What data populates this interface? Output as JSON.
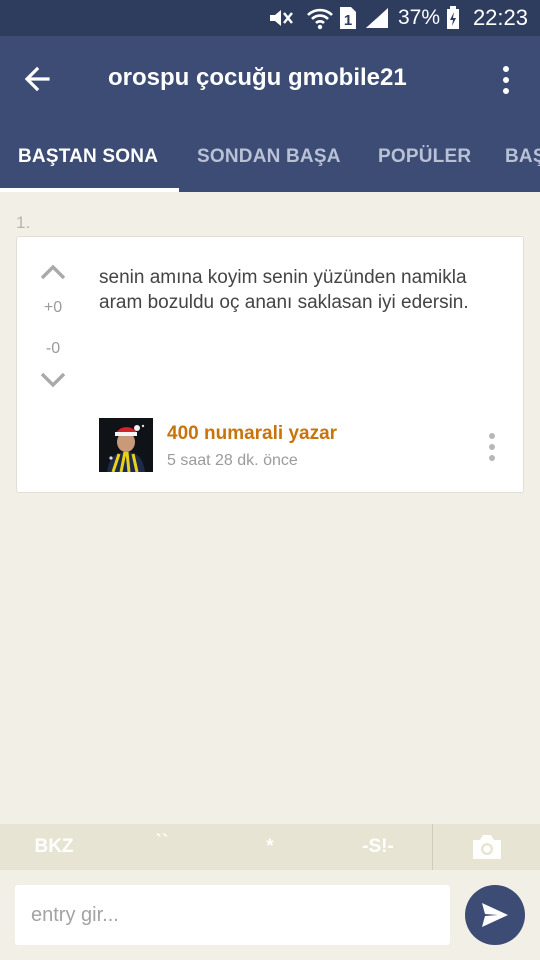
{
  "status_bar": {
    "battery_percent": "37%",
    "time": "22:23",
    "sim_slot": "1",
    "icons": [
      "mute-icon",
      "wifi-icon",
      "sim-icon",
      "signal-icon",
      "battery-charging-icon"
    ]
  },
  "app_bar": {
    "title": "orospu çocuğu gmobile21",
    "back_icon": "arrow-left-icon",
    "menu_icon": "more-vertical-icon"
  },
  "tabs": [
    {
      "label": "BAŞTAN SONA",
      "active": true
    },
    {
      "label": "SONDAN BAŞA",
      "active": false
    },
    {
      "label": "POPÜLER",
      "active": false
    },
    {
      "label": "BAŞ",
      "active": false
    }
  ],
  "entry": {
    "index": "1.",
    "upvotes": "+0",
    "downvotes": "-0",
    "text": "senin amına koyim senin yüzünden namikla aram bozuldu oç ananı saklasan iyi edersin.",
    "author": "400 numarali yazar",
    "time": "5 saat 28 dk. önce",
    "author_color": "#c8740a"
  },
  "format_toolbar": {
    "bkz": "BKZ",
    "backtick": "``",
    "star": "*",
    "spoiler": "-S!-",
    "camera_icon": "camera-icon"
  },
  "input": {
    "placeholder": "entry gir...",
    "send_icon": "send-icon"
  },
  "colors": {
    "primary": "#3d4c74",
    "status_bar": "#2e3c5e",
    "background": "#f2f0e6",
    "toolbar": "#e8e4d3"
  }
}
